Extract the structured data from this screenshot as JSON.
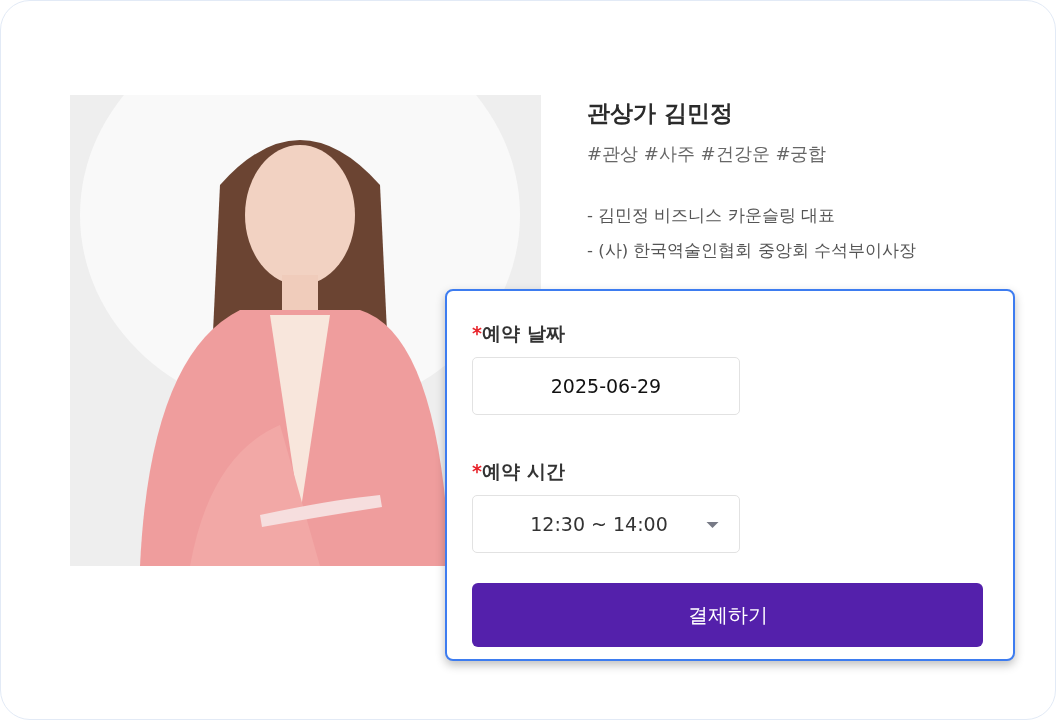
{
  "profile": {
    "name": "관상가 김민정",
    "tags": "#관상 #사주 #건강운 #궁합",
    "career": [
      "- 김민정 비즈니스 카운슬링 대표",
      "- (사) 한국역술인협회 중앙회 수석부이사장"
    ]
  },
  "booking": {
    "fields": [
      {
        "kind": "date",
        "required_mark": "*",
        "label": "예약 날짜",
        "value": "2025-06-29"
      },
      {
        "kind": "select",
        "required_mark": "*",
        "label": "예약 시간",
        "value": "12:30 ~ 14:00"
      }
    ],
    "submit": "결제하기"
  }
}
